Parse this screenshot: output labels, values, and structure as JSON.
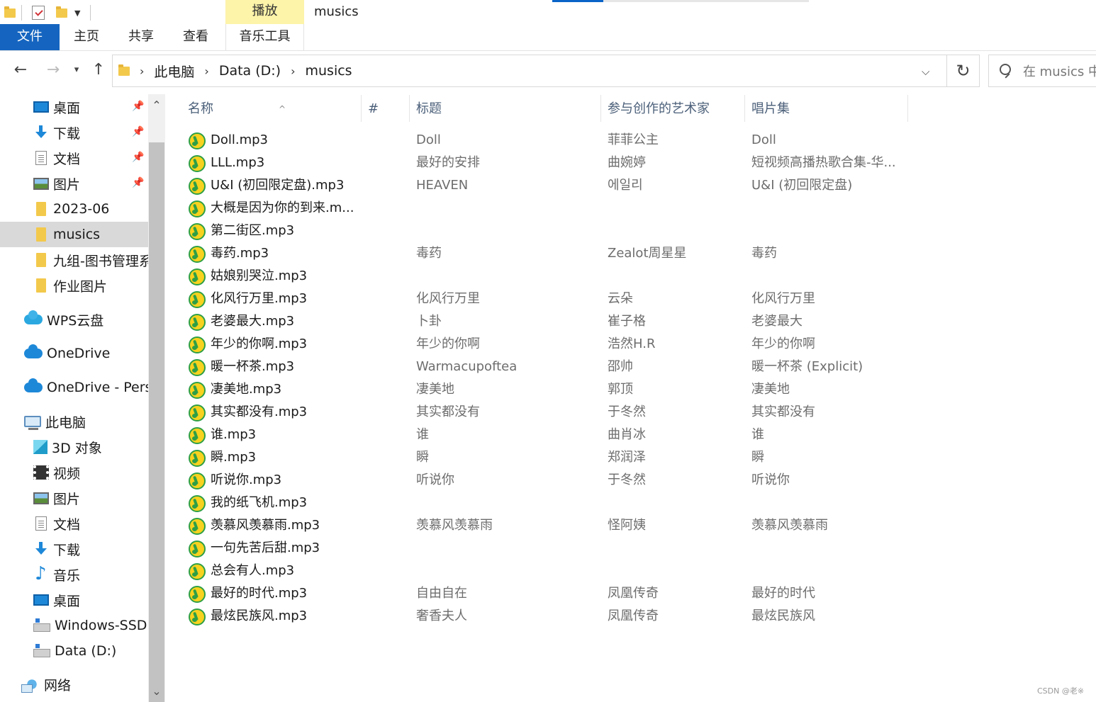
{
  "window": {
    "title": "musics",
    "contextual_tab_group": "播放"
  },
  "ribbon": {
    "tabs": [
      {
        "label": "文件"
      },
      {
        "label": "主页"
      },
      {
        "label": "共享"
      },
      {
        "label": "查看"
      },
      {
        "label": "音乐工具"
      }
    ]
  },
  "address": {
    "crumbs": [
      "此电脑",
      "Data (D:)",
      "musics"
    ],
    "search_placeholder": "在 musics 中"
  },
  "sidebar": {
    "items": [
      {
        "label": "桌面",
        "icon": "desktop-icon",
        "pinned": true
      },
      {
        "label": "下载",
        "icon": "download-icon",
        "pinned": true
      },
      {
        "label": "文档",
        "icon": "document-icon",
        "pinned": true
      },
      {
        "label": "图片",
        "icon": "pictures-icon",
        "pinned": true
      },
      {
        "label": "2023-06",
        "icon": "folder-icon"
      },
      {
        "label": "musics",
        "icon": "folder-icon",
        "selected": true
      },
      {
        "label": "九组-图书管理系",
        "icon": "folder-icon"
      },
      {
        "label": "作业图片",
        "icon": "folder-icon"
      },
      {
        "label": "WPS云盘",
        "icon": "wps-cloud-icon"
      },
      {
        "label": "OneDrive",
        "icon": "onedrive-icon"
      },
      {
        "label": "OneDrive - Persc",
        "icon": "onedrive-icon"
      },
      {
        "label": "此电脑",
        "icon": "this-pc-icon"
      },
      {
        "label": "3D 对象",
        "icon": "3d-objects-icon"
      },
      {
        "label": "视频",
        "icon": "video-icon"
      },
      {
        "label": "图片",
        "icon": "pictures-icon"
      },
      {
        "label": "文档",
        "icon": "document-icon"
      },
      {
        "label": "下载",
        "icon": "download-icon"
      },
      {
        "label": "音乐",
        "icon": "music-icon"
      },
      {
        "label": "桌面",
        "icon": "desktop-icon"
      },
      {
        "label": "Windows-SSD (",
        "icon": "drive-icon"
      },
      {
        "label": "Data (D:)",
        "icon": "drive-icon"
      },
      {
        "label": "网络",
        "icon": "network-icon"
      }
    ]
  },
  "columns": {
    "name": "名称",
    "number": "#",
    "title": "标题",
    "artist": "参与创作的艺术家",
    "album": "唱片集"
  },
  "files": [
    {
      "name": "Doll.mp3",
      "title": "Doll",
      "artist": "菲菲公主",
      "album": "Doll"
    },
    {
      "name": "LLL.mp3",
      "title": "最好的安排",
      "artist": "曲婉婷",
      "album": "短视频高播热歌合集-华..."
    },
    {
      "name": "U&I (初回限定盘).mp3",
      "title": "HEAVEN",
      "artist": "에일리",
      "album": "U&I (初回限定盘)"
    },
    {
      "name": "大概是因为你的到来.m...",
      "title": "",
      "artist": "",
      "album": ""
    },
    {
      "name": "第二街区.mp3",
      "title": "",
      "artist": "",
      "album": ""
    },
    {
      "name": "毒药.mp3",
      "title": "毒药",
      "artist": "Zealot周星星",
      "album": "毒药"
    },
    {
      "name": "姑娘别哭泣.mp3",
      "title": "",
      "artist": "",
      "album": ""
    },
    {
      "name": "化风行万里.mp3",
      "title": "化风行万里",
      "artist": "云朵",
      "album": "化风行万里"
    },
    {
      "name": "老婆最大.mp3",
      "title": "卜卦",
      "artist": "崔子格",
      "album": "老婆最大"
    },
    {
      "name": "年少的你啊.mp3",
      "title": "年少的你啊",
      "artist": "浩然H.R",
      "album": "年少的你啊"
    },
    {
      "name": "暖一杯茶.mp3",
      "title": "Warmacupoftea",
      "artist": "邵帅",
      "album": "暖一杯茶 (Explicit)"
    },
    {
      "name": "凄美地.mp3",
      "title": "凄美地",
      "artist": "郭顶",
      "album": "凄美地"
    },
    {
      "name": "其实都没有.mp3",
      "title": "其实都没有",
      "artist": "于冬然",
      "album": "其实都没有"
    },
    {
      "name": "谁.mp3",
      "title": "谁",
      "artist": "曲肖冰",
      "album": "谁"
    },
    {
      "name": "瞬.mp3",
      "title": "瞬",
      "artist": "郑润泽",
      "album": "瞬"
    },
    {
      "name": "听说你.mp3",
      "title": "听说你",
      "artist": "于冬然",
      "album": "听说你"
    },
    {
      "name": "我的纸飞机.mp3",
      "title": "",
      "artist": "",
      "album": ""
    },
    {
      "name": "羡慕风羡慕雨.mp3",
      "title": "羡慕风羡慕雨",
      "artist": "怪阿姨",
      "album": "羡慕风羡慕雨"
    },
    {
      "name": "一句先苦后甜.mp3",
      "title": "",
      "artist": "",
      "album": ""
    },
    {
      "name": "总会有人.mp3",
      "title": "",
      "artist": "",
      "album": ""
    },
    {
      "name": "最好的时代.mp3",
      "title": "自由自在",
      "artist": "凤凰传奇",
      "album": "最好的时代"
    },
    {
      "name": "最炫民族风.mp3",
      "title": "奢香夫人",
      "artist": "凤凰传奇",
      "album": "最炫民族风"
    }
  ],
  "watermark": "CSDN @老※"
}
